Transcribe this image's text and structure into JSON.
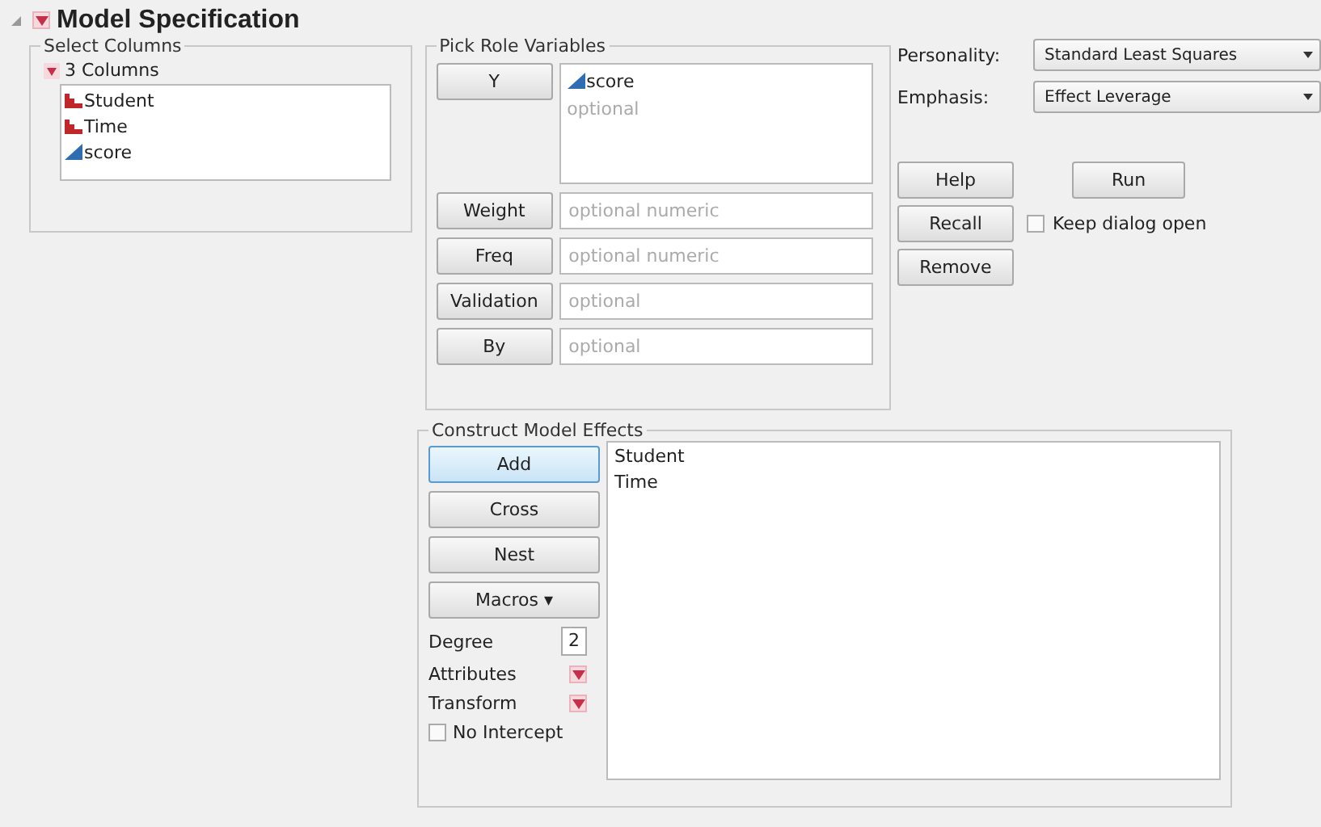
{
  "title": "Model Specification",
  "select_columns": {
    "title": "Select Columns",
    "group": "3 Columns",
    "expanded": true,
    "columns": [
      {
        "name": "Student",
        "kind": "nominal"
      },
      {
        "name": "Time",
        "kind": "nominal"
      },
      {
        "name": "score",
        "kind": "continuous"
      }
    ]
  },
  "pick_roles": {
    "title": "Pick Role Variables",
    "roles": [
      {
        "label": "Y",
        "kind": "list",
        "values": [
          {
            "name": "score",
            "kind": "continuous"
          }
        ],
        "placeholder": "optional"
      },
      {
        "label": "Weight",
        "kind": "field",
        "placeholder": "optional numeric"
      },
      {
        "label": "Freq",
        "kind": "field",
        "placeholder": "optional numeric"
      },
      {
        "label": "Validation",
        "kind": "field",
        "placeholder": "optional"
      },
      {
        "label": "By",
        "kind": "field",
        "placeholder": "optional"
      }
    ]
  },
  "personality": {
    "label": "Personality:",
    "value": "Standard Least Squares"
  },
  "emphasis": {
    "label": "Emphasis:",
    "value": "Effect Leverage"
  },
  "help_button": "Help",
  "run_button": "Run",
  "recall_button": "Recall",
  "remove_button": "Remove",
  "keep_open": {
    "label": "Keep dialog open",
    "checked": false
  },
  "effects": {
    "title": "Construct Model Effects",
    "buttons": [
      {
        "label": "Add",
        "focused": true
      },
      {
        "label": "Cross",
        "focused": false
      },
      {
        "label": "Nest",
        "focused": false
      }
    ],
    "macros": "Macros ▾",
    "degree": {
      "label": "Degree",
      "value": "2"
    },
    "attributes": "Attributes",
    "transform": "Transform",
    "no_intercept": {
      "label": "No Intercept",
      "checked": false
    },
    "items": [
      "Student",
      "Time"
    ]
  }
}
